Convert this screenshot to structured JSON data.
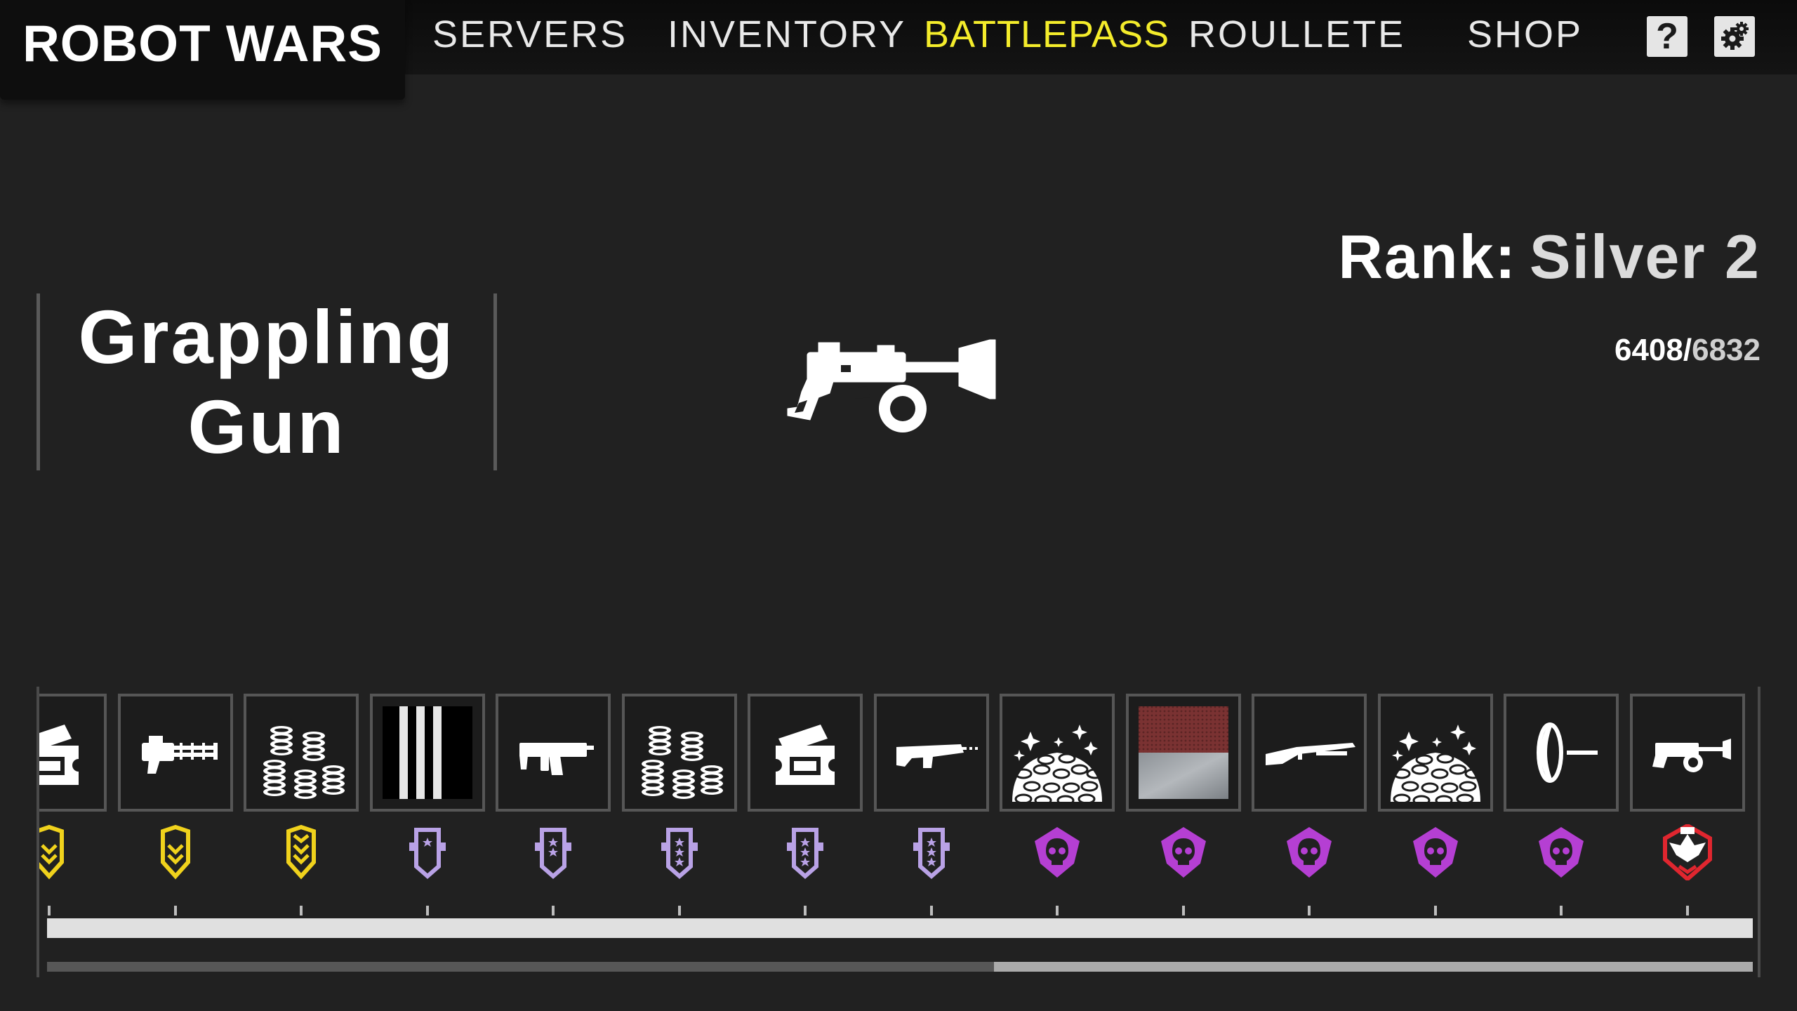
{
  "app_title": "ROBOT WARS",
  "nav": {
    "servers": "SERVERS",
    "inventory": "INVENTORY",
    "battlepass": "BATTLEPASS",
    "roulette": "ROULLETE",
    "shop": "SHOP",
    "active": "BATTLEPASS"
  },
  "top_buttons": {
    "help": "?",
    "settings_icon": "gear-icon"
  },
  "featured_item": {
    "name": "Grappling Gun",
    "icon": "grappling-gun-icon"
  },
  "rank": {
    "label": "Rank:",
    "value": "Silver 2"
  },
  "xp": {
    "current": "6408",
    "separator": "/",
    "required": "6832"
  },
  "rewards": [
    {
      "icon": "ticket-icon"
    },
    {
      "icon": "minigun-icon"
    },
    {
      "icon": "coin-stacks-icon"
    },
    {
      "icon": "stripes-skin-icon"
    },
    {
      "icon": "smg-icon"
    },
    {
      "icon": "coin-stacks-icon"
    },
    {
      "icon": "ticket-icon"
    },
    {
      "icon": "rifle-icon"
    },
    {
      "icon": "coin-pile-icon"
    },
    {
      "icon": "red-metal-skin-icon"
    },
    {
      "icon": "shotgun-icon"
    },
    {
      "icon": "coin-pile-icon"
    },
    {
      "icon": "plunger-icon"
    },
    {
      "icon": "grappling-gun-icon"
    }
  ],
  "tiers": [
    {
      "icon": "rank-badge-gold-1",
      "color": "#f0d21c"
    },
    {
      "icon": "rank-badge-gold-2",
      "color": "#f0d21c"
    },
    {
      "icon": "rank-badge-gold-3",
      "color": "#f0d21c"
    },
    {
      "icon": "rank-badge-silver-1",
      "color": "#b9a2e6"
    },
    {
      "icon": "rank-badge-silver-2",
      "color": "#b9a2e6"
    },
    {
      "icon": "rank-badge-silver-3",
      "color": "#b9a2e6"
    },
    {
      "icon": "rank-badge-silver-4",
      "color": "#b9a2e6"
    },
    {
      "icon": "rank-badge-silver-5",
      "color": "#b9a2e6"
    },
    {
      "icon": "rank-badge-skull-1",
      "color": "#b53fd3"
    },
    {
      "icon": "rank-badge-skull-2",
      "color": "#b53fd3"
    },
    {
      "icon": "rank-badge-skull-3",
      "color": "#b53fd3"
    },
    {
      "icon": "rank-badge-skull-4",
      "color": "#b53fd3"
    },
    {
      "icon": "rank-badge-skull-5",
      "color": "#b53fd3"
    },
    {
      "icon": "rank-badge-elite",
      "color": "#e0262f"
    }
  ],
  "track_scroll_position": 0.555,
  "colors": {
    "background": "#212121",
    "active_tab": "#f4ec2b",
    "gold_tier": "#f0d21c",
    "silver_tier": "#b9a2e6",
    "skull_tier": "#b53fd3",
    "elite_tier": "#e0262f"
  }
}
